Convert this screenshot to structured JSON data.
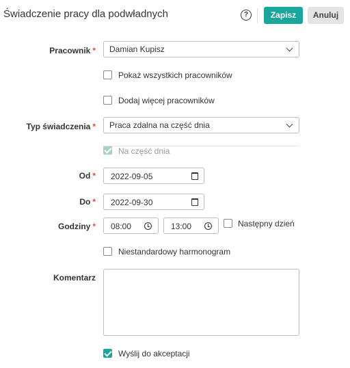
{
  "header": {
    "title": "Świadczenie pracy dla podwładnych",
    "help_icon": "question-circle-icon",
    "save_label": "Zapisz",
    "cancel_label": "Anuluj"
  },
  "colors": {
    "accent": "#1aa69a",
    "required": "#e74c3c"
  },
  "form": {
    "employee": {
      "label": "Pracownik",
      "value": "Damian Kupisz"
    },
    "show_all_employees": {
      "label": "Pokaż wszystkich pracowników",
      "checked": false
    },
    "add_more_employees": {
      "label": "Dodaj więcej pracowników",
      "checked": false
    },
    "benefit_type": {
      "label": "Typ świadczenia",
      "value": "Praca zdalna na część dnia"
    },
    "part_day": {
      "label": "Na część dnia",
      "checked": true,
      "disabled": true
    },
    "from": {
      "label": "Od",
      "value": "2022-09-05"
    },
    "to": {
      "label": "Do",
      "value": "2022-09-30"
    },
    "hours": {
      "label": "Godziny",
      "start": "08:00",
      "end": "13:00"
    },
    "next_day": {
      "label": "Następny dzień",
      "checked": false
    },
    "custom_schedule": {
      "label": "Niestandardowy harmonogram",
      "checked": false
    },
    "comment": {
      "label": "Komentarz",
      "value": ""
    },
    "send_for_approval": {
      "label": "Wyślij do akceptacji",
      "checked": true
    }
  }
}
